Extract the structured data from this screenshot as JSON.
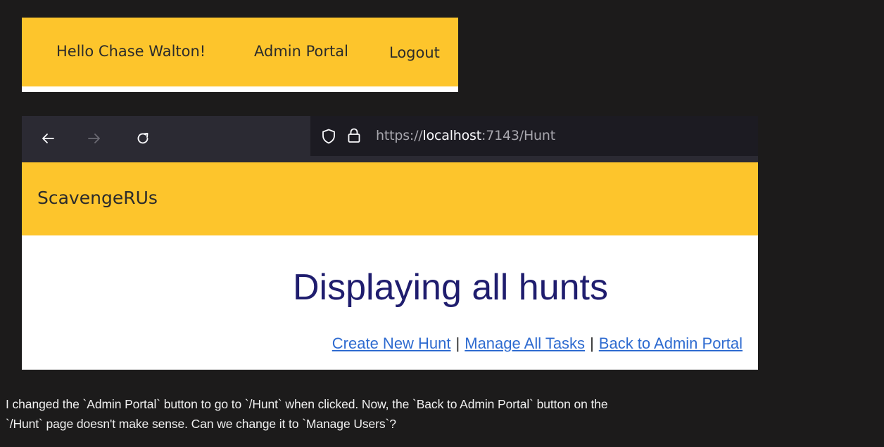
{
  "navbar": {
    "greeting": "Hello Chase Walton!",
    "admin_portal": "Admin Portal",
    "logout": "Logout",
    "bg_color": "#fdc52c"
  },
  "browser": {
    "toolbar": {
      "back_icon": "arrow-left-icon",
      "forward_icon": "arrow-right-icon",
      "reload_icon": "reload-icon"
    },
    "url": {
      "prefix": "https://",
      "host": "localhost",
      "suffix": ":7143/Hunt"
    }
  },
  "site": {
    "brand": "ScavengeRUs",
    "heading": "Displaying all hunts",
    "links": [
      {
        "label": "Create New Hunt"
      },
      {
        "label": "Manage All Tasks"
      },
      {
        "label": "Back to Admin Portal"
      }
    ],
    "separator": "|",
    "accent_color": "#fdc52c",
    "link_color": "#2e6bd0",
    "heading_color": "#1f1d6e"
  },
  "caption": {
    "line1": "I changed the `Admin Portal` button to go to `/Hunt` when clicked. Now, the `Back to Admin Portal` button on the",
    "line2": "`/Hunt` page doesn't make sense. Can we change it to `Manage Users`?"
  }
}
